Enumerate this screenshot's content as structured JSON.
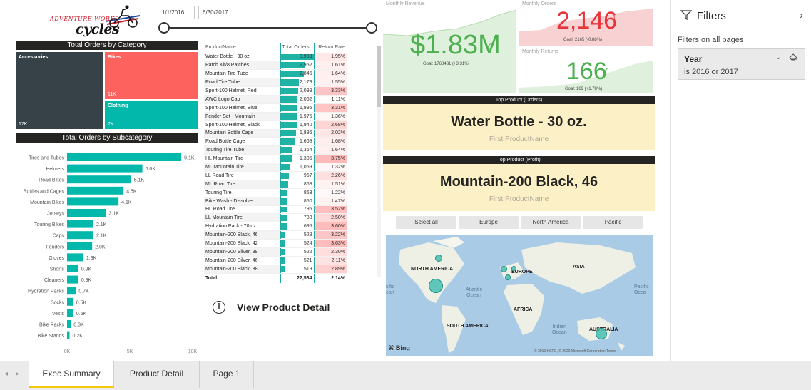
{
  "logo": {
    "line1": "ADVENTURE WORKS",
    "line2": "cycles"
  },
  "slicer": {
    "start_date": "1/1/2016",
    "end_date": "6/30/2017"
  },
  "treemap": {
    "title": "Total Orders by Category",
    "tiles": [
      {
        "name": "Accessories",
        "value": "17K",
        "color": "#374248"
      },
      {
        "name": "Bikes",
        "value": "11K",
        "color": "#fd625e"
      },
      {
        "name": "Clothing",
        "value": "7K",
        "color": "#01b8aa"
      }
    ]
  },
  "subcategory_chart": {
    "title": "Total Orders by Subcategory",
    "chart_data": {
      "type": "bar",
      "orientation": "horizontal",
      "categories": [
        "Tires and Tubes",
        "Helmets",
        "Road Bikes",
        "Bottles and Cages",
        "Mountain Bikes",
        "Jerseys",
        "Touring Bikes",
        "Caps",
        "Fenders",
        "Gloves",
        "Shorts",
        "Cleaners",
        "Hydration Packs",
        "Socks",
        "Vests",
        "Bike Racks",
        "Bike Stands"
      ],
      "values": [
        9.1,
        6.0,
        5.1,
        4.5,
        4.1,
        3.1,
        2.1,
        2.1,
        2.0,
        1.3,
        0.9,
        0.9,
        0.7,
        0.5,
        0.5,
        0.3,
        0.2
      ],
      "value_labels": [
        "9.1K",
        "6.0K",
        "5.1K",
        "4.5K",
        "4.1K",
        "3.1K",
        "2.1K",
        "2.1K",
        "2.0K",
        "1.3K",
        "0.9K",
        "0.9K",
        "0.7K",
        "0.5K",
        "0.5K",
        "0.3K",
        "0.2K"
      ],
      "unit": "K",
      "xlim": [
        0,
        10
      ],
      "xticks": [
        "0K",
        "5K",
        "10K"
      ],
      "color": "#01b8aa"
    }
  },
  "product_table": {
    "headers": [
      "ProductName",
      "Total Orders",
      "Return Rate"
    ],
    "rows": [
      [
        "Water Bottle - 30 oz.",
        "3,983",
        "1.95%",
        3983
      ],
      [
        "Patch Kit/8 Patches",
        "2,952",
        "1.61%",
        2952
      ],
      [
        "Mountain Tire Tube",
        "2,846",
        "1.64%",
        2846
      ],
      [
        "Road Tire Tube",
        "2,173",
        "1.55%",
        2173
      ],
      [
        "Sport-100 Helmet, Red",
        "2,099",
        "3.33%",
        2099
      ],
      [
        "AWC Logo Cap",
        "2,062",
        "1.11%",
        2062
      ],
      [
        "Sport-100 Helmet, Blue",
        "1,995",
        "3.31%",
        1995
      ],
      [
        "Fender Set - Mountain",
        "1,975",
        "1.36%",
        1975
      ],
      [
        "Sport-100 Helmet, Black",
        "1,940",
        "2.68%",
        1940
      ],
      [
        "Mountain Bottle Cage",
        "1,896",
        "2.02%",
        1896
      ],
      [
        "Road Bottle Cage",
        "1,668",
        "1.68%",
        1668
      ],
      [
        "Touring Tire Tube",
        "1,364",
        "1.64%",
        1364
      ],
      [
        "HL Mountain Tire",
        "1,305",
        "3.75%",
        1305
      ],
      [
        "ML Mountain Tire",
        "1,059",
        "1.32%",
        1059
      ],
      [
        "LL Road Tire",
        "957",
        "2.26%",
        957
      ],
      [
        "ML Road Tire",
        "868",
        "1.51%",
        868
      ],
      [
        "Touring Tire",
        "863",
        "1.22%",
        863
      ],
      [
        "Bike Wash - Dissolver",
        "850",
        "1.47%",
        850
      ],
      [
        "HL Road Tire",
        "795",
        "3.52%",
        795
      ],
      [
        "LL Mountain Tire",
        "788",
        "2.50%",
        788
      ],
      [
        "Hydration Pack - 70 oz.",
        "695",
        "3.60%",
        695
      ],
      [
        "Mountain-200 Black, 46",
        "528",
        "3.22%",
        528
      ],
      [
        "Mountain-200 Black, 42",
        "524",
        "3.63%",
        524
      ],
      [
        "Mountain-200 Silver, 38",
        "522",
        "2.30%",
        522
      ],
      [
        "Mountain-200 Silver, 46",
        "521",
        "2.11%",
        521
      ],
      [
        "Mountain-200 Black, 38",
        "519",
        "2.89%",
        519
      ]
    ],
    "total": [
      "Total",
      "22,534",
      "2.14%"
    ],
    "max_orders": 3983
  },
  "detail_link": {
    "icon": "i",
    "label": "View Product Detail"
  },
  "kpis": {
    "revenue": {
      "title": "Monthly Revenue",
      "value": "$1.83M",
      "check": "✓",
      "goal": "Goal: 1768431 (+3.31%)"
    },
    "orders": {
      "title": "Monthly Orders",
      "value": "2,146",
      "mark": "!",
      "goal": "Goal: 2165 (-0.88%)"
    },
    "returns": {
      "title": "Monthly Returns",
      "value": "166",
      "check": "✓",
      "goal": "Goal: 169 (+1.78%)"
    }
  },
  "top_orders": {
    "header": "Top Product (Orders)",
    "value": "Water Bottle - 30 oz.",
    "subtitle": "First ProductName"
  },
  "top_profit": {
    "header": "Top Product (Profit)",
    "value": "Mountain-200 Black, 46",
    "subtitle": "First ProductName"
  },
  "regions": [
    "Select all",
    "Europe",
    "North America",
    "Pacific"
  ],
  "map": {
    "continents": [
      "NORTH AMERICA",
      "EUROPE",
      "ASIA",
      "AFRICA",
      "SOUTH AMERICA",
      "AUSTRALIA"
    ],
    "oceans": [
      "cific\nean",
      "Atlantic\nOcean",
      "Indian\nOcean",
      "Pacific\nOcea"
    ],
    "attribution": "Bing",
    "copyright": "© 2019 HERE, © 2020 Microsoft Corporation Terms"
  },
  "filters": {
    "title": "Filters",
    "subtitle": "Filters on all pages",
    "card": {
      "name": "Year",
      "value": "is 2016 or 2017"
    }
  },
  "tabs": [
    {
      "label": "Exec Summary",
      "active": true
    },
    {
      "label": "Product Detail",
      "active": false
    },
    {
      "label": "Page 1",
      "active": false
    }
  ],
  "colors": {
    "teal": "#01b8aa",
    "red": "#fd625e",
    "dark": "#374248",
    "green": "#4caf50",
    "kpi_red": "#e8333b",
    "banner": "#fcf0c6"
  }
}
